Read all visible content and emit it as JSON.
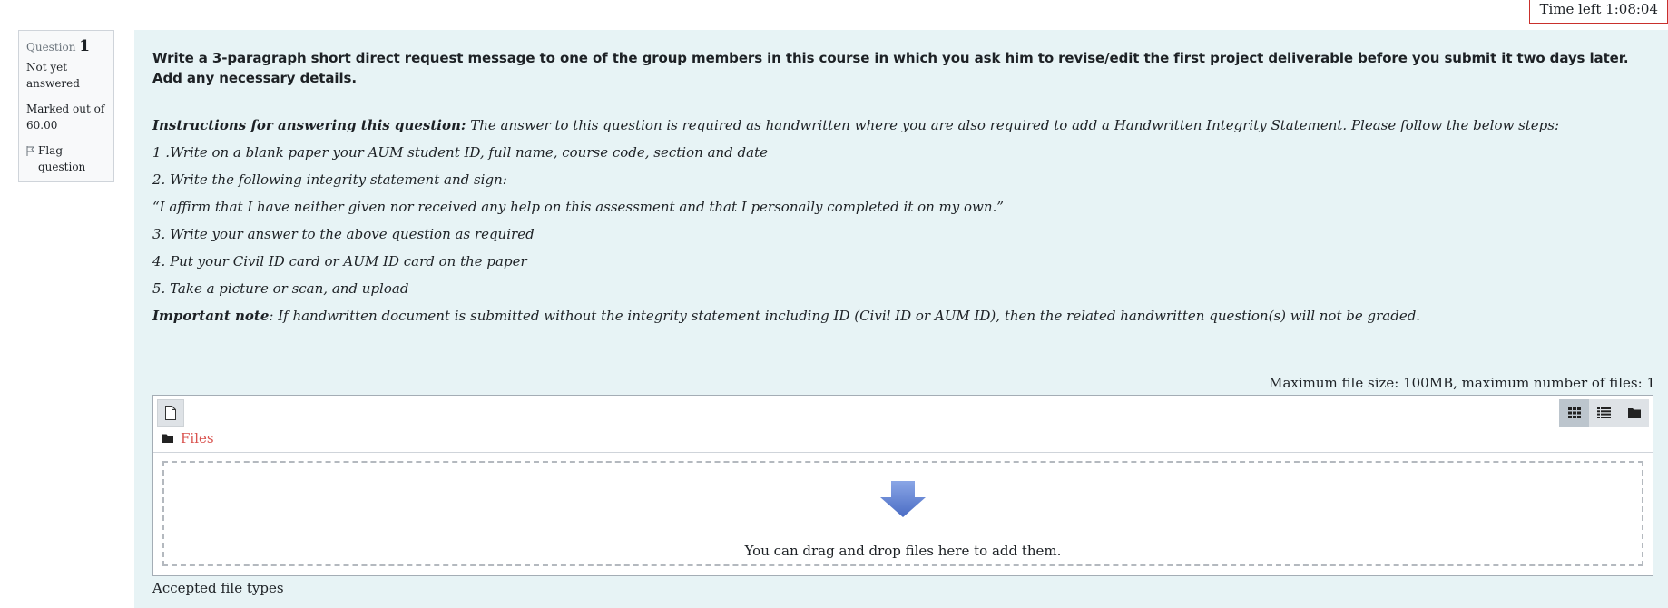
{
  "timer": {
    "label": "Time left",
    "value": "1:08:04"
  },
  "question_info": {
    "label": "Question",
    "number": "1",
    "state": "Not yet answered",
    "grade": "Marked out of 60.00",
    "flag": "Flag question"
  },
  "question": {
    "text": "Write a 3-paragraph short direct request message to one of the group members in this course in which you ask him to revise/edit the first project deliverable before you submit it two days later. Add any necessary details.",
    "instructions_label": "Instructions for answering this question:",
    "instructions_text": " The answer to this question is required as handwritten where you are also required to add a Handwritten Integrity Statement. Please follow the below steps:",
    "steps": [
      "1 .Write on a blank paper your AUM student ID, full name, course code, section and date",
      "2. Write the following integrity statement and sign:",
      "“I affirm that I have neither given nor received any help on this assessment and that I personally completed it on my own.”",
      "3. Write your answer to the above question as required",
      "4. Put your Civil ID card or AUM ID card on the paper",
      "5. Take a picture or scan, and upload"
    ],
    "note_label": "Important note",
    "note_text": ": If handwritten document is submitted without the integrity statement including ID (Civil ID or AUM ID), then the related handwritten question(s) will not be graded."
  },
  "filemanager": {
    "max_size": "Maximum file size: 100MB, maximum number of files: 1",
    "path_label": "Files",
    "drop_message": "You can drag and drop files here to add them.",
    "accepted_label": "Accepted file types",
    "icons": {
      "add": "file-add-icon",
      "grid": "grid-view-icon",
      "list": "list-view-icon",
      "tree": "folder-tree-icon",
      "folder": "folder-icon",
      "arrow": "drop-arrow-icon"
    },
    "colors": {
      "link": "#d9534f",
      "arrow": "#5b7dd1",
      "panel": "#e7f3f5"
    }
  }
}
